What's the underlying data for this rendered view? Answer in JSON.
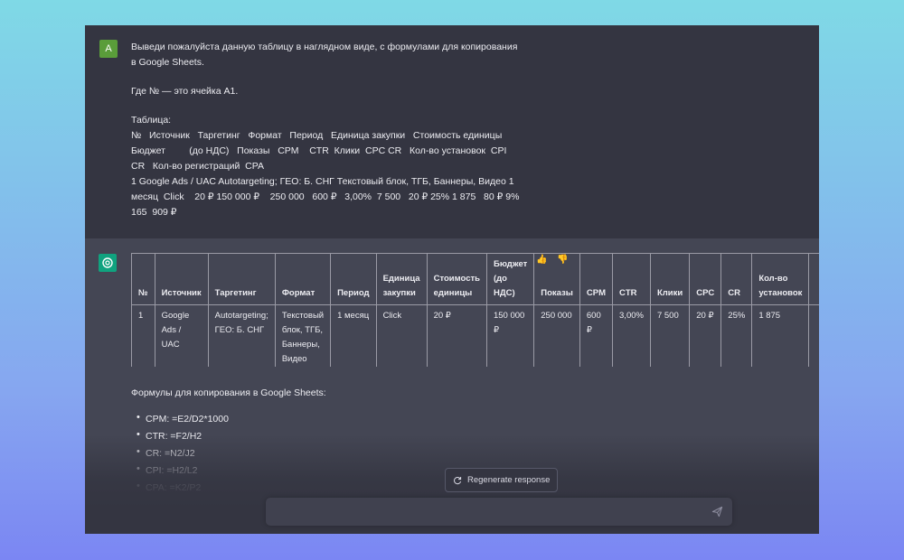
{
  "user": {
    "avatar_letter": "A",
    "lines": [
      "Выведи пожалуйста данную таблицу в наглядном виде, с формулами для копирования",
      "в Google Sheets.",
      "Где № — это ячейка A1.",
      "Таблица:",
      "№   Источник   Таргетинг   Формат   Период   Единица закупки   Стоимость единицы",
      "Бюджет         (до НДС)   Показы   CPM    CTR  Клики  CPC CR   Кол-во установок  CPI",
      "CR   Кол-во регистраций  CPA",
      "1  Google Ads / UAC   Autotargeting; ГЕО: Б. СНГ Текстовый блок, ТГБ, Баннеры, Видео 1",
      "месяц  Click    20 ₽ 150 000 ₽    250 000   600 ₽   3,00%  7 500   20 ₽ 25% 1 875   80 ₽ 9%",
      "165  909 ₽"
    ]
  },
  "feedback": {
    "like": "👍",
    "dislike": "👎"
  },
  "table": {
    "headers": [
      "№",
      "Источник",
      "Таргетинг",
      "Формат",
      "Период",
      "Единица закупки",
      "Стоимость единицы",
      "Бюджет (до НДС)",
      "Показы",
      "CPM",
      "CTR",
      "Клики",
      "CPC",
      "CR",
      "Кол-во установок",
      ""
    ],
    "rows": [
      [
        "1",
        "Google Ads / UAC",
        "Autotargeting; ГЕО: Б. СНГ",
        "Текстовый блок, ТГБ, Баннеры, Видео",
        "1 месяц",
        "Click",
        "20 ₽",
        "150 000 ₽",
        "250 000",
        "600 ₽",
        "3,00%",
        "7 500",
        "20 ₽",
        "25%",
        "1 875",
        ""
      ]
    ]
  },
  "formulas": {
    "heading": "Формулы для копирования в Google Sheets:",
    "items": [
      "CPM: =E2/D2*1000",
      "CTR: =F2/H2",
      "CR: =N2/J2",
      "CPI: =H2/L2",
      "CPA: =K2/P2"
    ]
  },
  "regenerate_label": "Regenerate response",
  "input": {
    "placeholder": ""
  }
}
